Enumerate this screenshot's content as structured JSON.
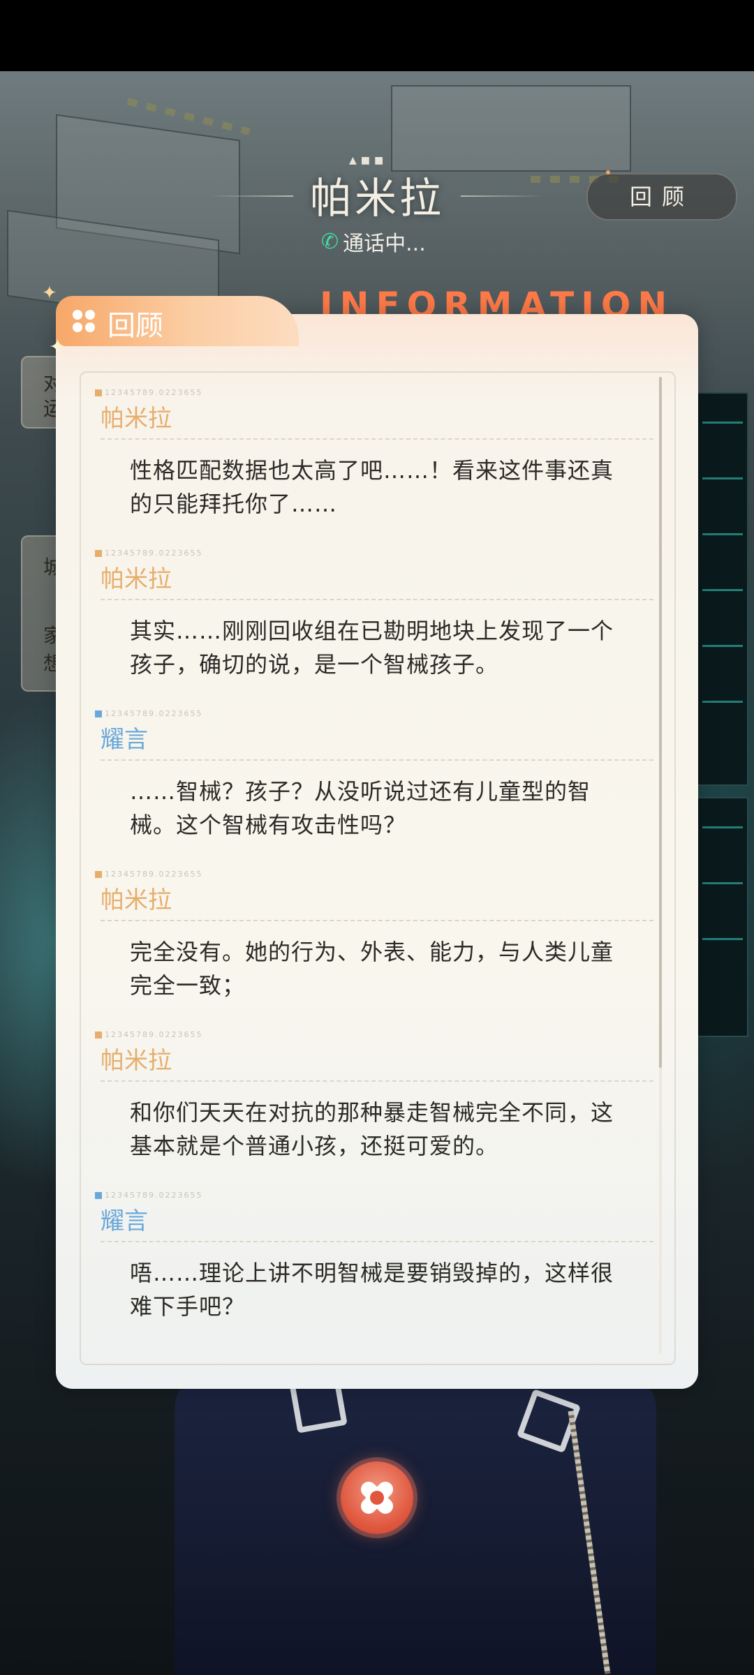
{
  "header": {
    "caller_name": "帕米拉",
    "call_status": "通话中...",
    "review_button": "回顾",
    "information_word": "INFORMATION",
    "phone_icon": "phone-icon"
  },
  "panel": {
    "title": "回顾",
    "title_icon": "grid-icon",
    "meta_code": "12345789.0223655"
  },
  "messages": [
    {
      "speaker": "帕米拉",
      "speaker_color": "#e6ae6c",
      "text": "性格匹配数据也太高了吧……！看来这件事还真的只能拜托你了……"
    },
    {
      "speaker": "帕米拉",
      "speaker_color": "#e6ae6c",
      "text": "其实……刚刚回收组在已勘明地块上发现了一个孩子，确切的说，是一个智械孩子。"
    },
    {
      "speaker": "耀言",
      "speaker_color": "#6aa8d8",
      "text": "……智械？孩子？从没听说过还有儿童型的智械。这个智械有攻击性吗？"
    },
    {
      "speaker": "帕米拉",
      "speaker_color": "#e6ae6c",
      "text": "完全没有。她的行为、外表、能力，与人类儿童完全一致；"
    },
    {
      "speaker": "帕米拉",
      "speaker_color": "#e6ae6c",
      "text": "和你们天天在对抗的那种暴走智械完全不同，这基本就是个普通小孩，还挺可爱的。"
    },
    {
      "speaker": "耀言",
      "speaker_color": "#6aa8d8",
      "text": "唔……理论上讲不明智械是要销毁掉的，这样很难下手吧？"
    }
  ],
  "side_tabs": [
    {
      "char1": "对",
      "char2": "运"
    },
    {
      "char1": "城",
      "char2": "家",
      "char3": "想"
    }
  ],
  "close_button": {
    "icon": "close-icon"
  }
}
